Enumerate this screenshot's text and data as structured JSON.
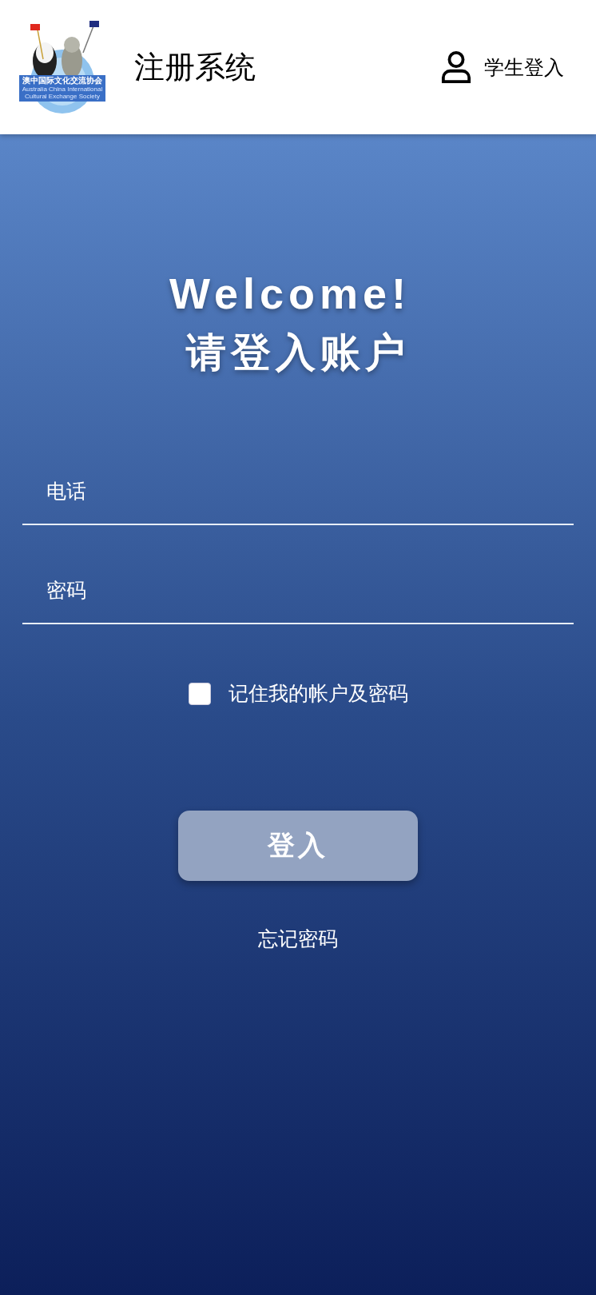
{
  "header": {
    "logo": {
      "banner_text": "澳中国际文化交流协会",
      "subtitle": "Australia China International Cultural Exchange Society"
    },
    "title": "注册系统",
    "login_link": "学生登入"
  },
  "welcome": {
    "line_1": "Welcome!",
    "line_2": "请登入账户"
  },
  "fields": [
    {
      "placeholder": "电话"
    },
    {
      "placeholder": "密码"
    }
  ],
  "remember": {
    "label": "记住我的帐户及密码",
    "checked": false
  },
  "login_button": "登入",
  "forgot_link": "忘记密码"
}
